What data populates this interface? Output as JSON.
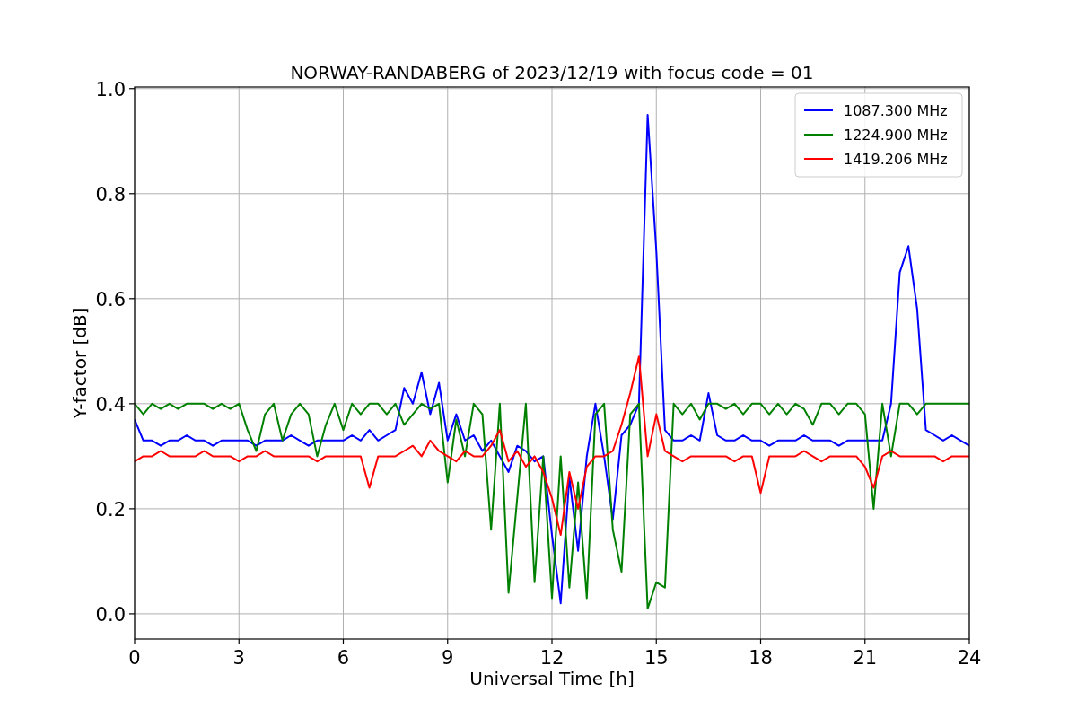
{
  "chart_data": {
    "type": "line",
    "title": "NORWAY-RANDABERG of 2023/12/19 with focus code = 01",
    "xlabel": "Universal Time [h]",
    "ylabel": "Y-factor [dB]",
    "x": [
      0,
      0.25,
      0.5,
      0.75,
      1,
      1.25,
      1.5,
      1.75,
      2,
      2.25,
      2.5,
      2.75,
      3,
      3.25,
      3.5,
      3.75,
      4,
      4.25,
      4.5,
      4.75,
      5,
      5.25,
      5.5,
      5.75,
      6,
      6.25,
      6.5,
      6.75,
      7,
      7.25,
      7.5,
      7.75,
      8,
      8.25,
      8.5,
      8.75,
      9,
      9.25,
      9.5,
      9.75,
      10,
      10.25,
      10.5,
      10.75,
      11,
      11.25,
      11.5,
      11.75,
      12,
      12.25,
      12.5,
      12.75,
      13,
      13.25,
      13.5,
      13.75,
      14,
      14.25,
      14.5,
      14.75,
      15,
      15.25,
      15.5,
      15.75,
      16,
      16.25,
      16.5,
      16.75,
      17,
      17.25,
      17.5,
      17.75,
      18,
      18.25,
      18.5,
      18.75,
      19,
      19.25,
      19.5,
      19.75,
      20,
      20.25,
      20.5,
      20.75,
      21,
      21.25,
      21.5,
      21.75,
      22,
      22.25,
      22.5,
      22.75,
      23,
      23.25,
      23.5,
      23.75,
      24
    ],
    "series": [
      {
        "name": "1087.300 MHz",
        "color": "#0000ff",
        "values": [
          0.37,
          0.33,
          0.33,
          0.32,
          0.33,
          0.33,
          0.34,
          0.33,
          0.33,
          0.32,
          0.33,
          0.33,
          0.33,
          0.33,
          0.32,
          0.33,
          0.33,
          0.33,
          0.34,
          0.33,
          0.32,
          0.33,
          0.33,
          0.33,
          0.33,
          0.34,
          0.33,
          0.35,
          0.33,
          0.34,
          0.35,
          0.43,
          0.4,
          0.46,
          0.38,
          0.44,
          0.33,
          0.38,
          0.33,
          0.34,
          0.31,
          0.33,
          0.3,
          0.27,
          0.32,
          0.31,
          0.29,
          0.3,
          0.15,
          0.02,
          0.26,
          0.12,
          0.3,
          0.4,
          0.3,
          0.18,
          0.34,
          0.36,
          0.4,
          0.95,
          0.69,
          0.35,
          0.33,
          0.33,
          0.34,
          0.33,
          0.42,
          0.34,
          0.33,
          0.33,
          0.34,
          0.33,
          0.33,
          0.32,
          0.33,
          0.33,
          0.33,
          0.34,
          0.33,
          0.33,
          0.33,
          0.32,
          0.33,
          0.33,
          0.33,
          0.33,
          0.33,
          0.4,
          0.65,
          0.7,
          0.58,
          0.35,
          0.34,
          0.33,
          0.34,
          0.33,
          0.32
        ]
      },
      {
        "name": "1224.900 MHz",
        "color": "#008000",
        "values": [
          0.4,
          0.38,
          0.4,
          0.39,
          0.4,
          0.39,
          0.4,
          0.4,
          0.4,
          0.39,
          0.4,
          0.39,
          0.4,
          0.35,
          0.31,
          0.38,
          0.4,
          0.33,
          0.38,
          0.4,
          0.38,
          0.3,
          0.36,
          0.4,
          0.35,
          0.4,
          0.38,
          0.4,
          0.4,
          0.38,
          0.4,
          0.36,
          0.38,
          0.4,
          0.39,
          0.4,
          0.25,
          0.37,
          0.3,
          0.4,
          0.38,
          0.16,
          0.4,
          0.04,
          0.22,
          0.4,
          0.06,
          0.3,
          0.03,
          0.3,
          0.05,
          0.25,
          0.03,
          0.38,
          0.4,
          0.16,
          0.08,
          0.38,
          0.4,
          0.01,
          0.06,
          0.05,
          0.4,
          0.38,
          0.4,
          0.37,
          0.4,
          0.4,
          0.39,
          0.4,
          0.38,
          0.4,
          0.4,
          0.38,
          0.4,
          0.38,
          0.4,
          0.39,
          0.36,
          0.4,
          0.4,
          0.38,
          0.4,
          0.4,
          0.38,
          0.2,
          0.4,
          0.3,
          0.4,
          0.4,
          0.38,
          0.4,
          0.4,
          0.4,
          0.4,
          0.4,
          0.4
        ]
      },
      {
        "name": "1419.206 MHz",
        "color": "#ff0000",
        "values": [
          0.29,
          0.3,
          0.3,
          0.31,
          0.3,
          0.3,
          0.3,
          0.3,
          0.31,
          0.3,
          0.3,
          0.3,
          0.29,
          0.3,
          0.3,
          0.31,
          0.3,
          0.3,
          0.3,
          0.3,
          0.3,
          0.29,
          0.3,
          0.3,
          0.3,
          0.3,
          0.3,
          0.24,
          0.3,
          0.3,
          0.3,
          0.31,
          0.32,
          0.3,
          0.33,
          0.31,
          0.3,
          0.29,
          0.31,
          0.3,
          0.3,
          0.32,
          0.35,
          0.29,
          0.31,
          0.28,
          0.3,
          0.27,
          0.22,
          0.15,
          0.27,
          0.2,
          0.28,
          0.3,
          0.3,
          0.31,
          0.36,
          0.42,
          0.49,
          0.3,
          0.38,
          0.31,
          0.3,
          0.29,
          0.3,
          0.3,
          0.3,
          0.3,
          0.3,
          0.29,
          0.3,
          0.3,
          0.23,
          0.3,
          0.3,
          0.3,
          0.3,
          0.31,
          0.3,
          0.29,
          0.3,
          0.3,
          0.3,
          0.3,
          0.28,
          0.24,
          0.3,
          0.31,
          0.3,
          0.3,
          0.3,
          0.3,
          0.3,
          0.29,
          0.3,
          0.3,
          0.3
        ]
      }
    ],
    "grid": true,
    "legend": true,
    "xlim": [
      0,
      24
    ],
    "ylim": [
      -0.048,
      1.003
    ],
    "xticks": [
      0,
      3,
      6,
      9,
      12,
      15,
      18,
      21,
      24
    ],
    "yticks": [
      {
        "value": 0,
        "label": "0.0"
      },
      {
        "value": 0.2,
        "label": "0.2"
      },
      {
        "value": 0.4,
        "label": "0.4"
      },
      {
        "value": 0.6,
        "label": "0.6"
      },
      {
        "value": 0.8,
        "label": "0.8"
      },
      {
        "value": 1,
        "label": "1.0"
      }
    ]
  }
}
